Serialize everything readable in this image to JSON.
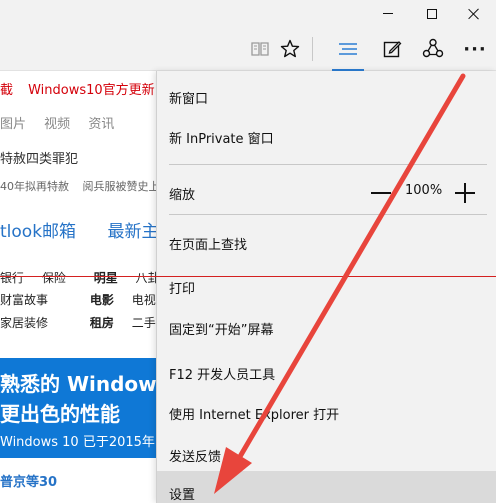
{
  "window": {
    "minimize_icon": "minimize-icon",
    "maximize_icon": "maximize-icon",
    "close_icon": "close-icon"
  },
  "toolbar": {
    "reading_icon": "book-icon",
    "favorite_icon": "star-icon",
    "hub_icon": "hub-lines-icon",
    "note_icon": "pen-note-icon",
    "share_icon": "share-icon",
    "more_label": "···",
    "accent": "#2b7cd3"
  },
  "webpage": {
    "top_left": "截",
    "top_link": "Windows10官方更新",
    "nav_links": [
      "图片",
      "视频",
      "资讯"
    ],
    "headline": "特赦四类罪犯",
    "sub_news_1": "40年拟再特赦",
    "sub_news_2": "阅兵服被赞史上",
    "outlook_link": "tlook邮箱",
    "theme_link": "最新主题",
    "categories": [
      {
        "a": "银行",
        "b": "保险",
        "c": "明星",
        "d": "八卦"
      },
      {
        "a": "财富故事",
        "c": "电影",
        "d": "电视"
      },
      {
        "a": "家居装修",
        "c": "租房",
        "d": "二手"
      }
    ],
    "banner": {
      "line1": "熟悉的 Window",
      "line2": "更出色的性能",
      "line3": "Windows 10 已于2015年"
    },
    "news_bottom": "普京等30",
    "brand_red": "#d4000a",
    "banner_blue": "#0f78d6"
  },
  "menu": {
    "new_window": "新窗口",
    "new_private": "新 InPrivate 窗口",
    "zoom_label": "缩放",
    "zoom_value": "100%",
    "find": "在页面上查找",
    "print": "打印",
    "pin_start": "固定到“开始”屏幕",
    "f12": "F12 开发人员工具",
    "open_ie": "使用 Internet Explorer 打开",
    "feedback": "发送反馈",
    "settings": "设置"
  },
  "annotation": {
    "arrow_color": "#e8453c"
  }
}
